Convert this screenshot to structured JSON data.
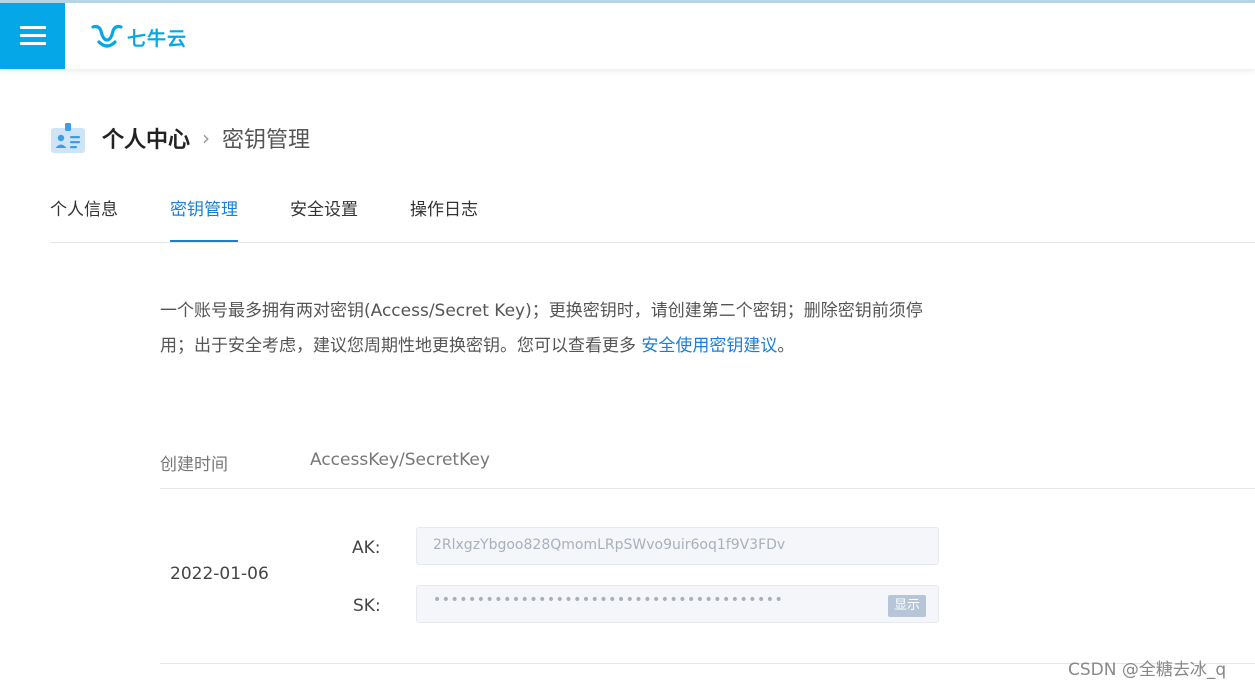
{
  "header": {
    "logo_text": "七牛云",
    "brand_color": "#06a7e7",
    "menu_icon": "hamburger-menu-icon"
  },
  "breadcrumb": {
    "main": "个人中心",
    "separator": ">",
    "current": "密钥管理",
    "icon": "id-card-icon"
  },
  "tabs": [
    {
      "label": "个人信息",
      "active": false
    },
    {
      "label": "密钥管理",
      "active": true
    },
    {
      "label": "安全设置",
      "active": false
    },
    {
      "label": "操作日志",
      "active": false
    }
  ],
  "notice": {
    "line1": "一个账号最多拥有两对密钥(Access/Secret Key)；更换密钥时，请创建第二个密钥；删除密钥前须停",
    "line2_prefix": "用；出于安全考虑，建议您周期性地更换密钥。您可以查看更多 ",
    "link_text": "安全使用密钥建议",
    "line2_suffix": "。"
  },
  "table": {
    "headers": [
      "创建时间",
      "AccessKey/SecretKey"
    ],
    "rows": [
      {
        "created": "2022-01-06",
        "ak_label": "AK:",
        "ak_value": "2RlxgzYbgoo828QmomLRpSWvo9uir6oq1f9V3FDv",
        "sk_label": "SK:",
        "sk_value": "••••••••••••••••••••••••••••••••••••••••",
        "show_button": "显示"
      }
    ]
  },
  "watermark": "CSDN @全糖去冰_q",
  "colors": {
    "link": "#1a7fd4",
    "divider": "#e3e6ea",
    "input_bg": "#f4f6f9"
  }
}
